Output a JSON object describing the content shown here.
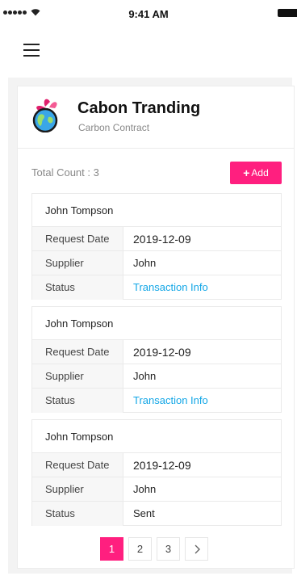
{
  "status_bar": {
    "time": "9:41 AM"
  },
  "brand": {
    "title": "Cabon Tranding",
    "subtitle": "Carbon Contract"
  },
  "toolbar": {
    "total_count": "Total Count : 3",
    "add_label": "Add"
  },
  "records": [
    {
      "name": "John Tompson",
      "request_date_label": "Request Date",
      "request_date": "2019-12-09",
      "supplier_label": "Supplier",
      "supplier": "John",
      "status_label": "Status",
      "status": "Transaction Info"
    },
    {
      "name": "John Tompson",
      "request_date_label": "Request Date",
      "request_date": "2019-12-09",
      "supplier_label": "Supplier",
      "supplier": "John",
      "status_label": "Status",
      "status": "Transaction Info"
    },
    {
      "name": "John Tompson",
      "request_date_label": "Request Date",
      "request_date": "2019-12-09",
      "supplier_label": "Supplier",
      "supplier": "John",
      "status_label": "Status",
      "status": "Sent"
    }
  ],
  "pagination": {
    "pages": [
      "1",
      "2",
      "3"
    ],
    "current": "1",
    "next_icon": "chevron-right-icon"
  },
  "colors": {
    "accent": "#ff1f7f",
    "link": "#12a6e6"
  }
}
